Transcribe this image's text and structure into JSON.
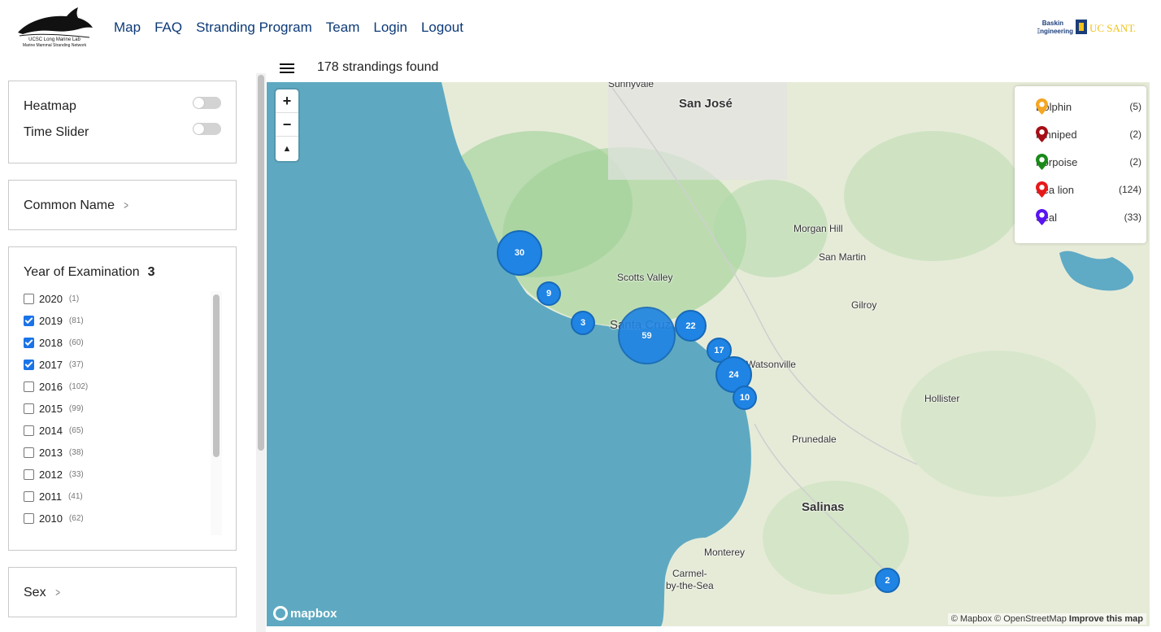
{
  "header": {
    "logo_alt": "UCSC Long Marine Lab Marine Mammal Stranding Network",
    "nav": [
      "Map",
      "FAQ",
      "Stranding Program",
      "Team",
      "Login",
      "Logout"
    ],
    "partner_logo": "Baskin Engineering UC Santa Cruz"
  },
  "status": {
    "found_text": "178 strandings found"
  },
  "filters": {
    "heatmap_label": "Heatmap",
    "timeslider_label": "Time Slider",
    "common_name_label": "Common Name",
    "year_label": "Year of Examination",
    "year_selected_count": "3",
    "years": [
      {
        "year": "2020",
        "count": "(1)",
        "checked": false
      },
      {
        "year": "2019",
        "count": "(81)",
        "checked": true
      },
      {
        "year": "2018",
        "count": "(60)",
        "checked": true
      },
      {
        "year": "2017",
        "count": "(37)",
        "checked": true
      },
      {
        "year": "2016",
        "count": "(102)",
        "checked": false
      },
      {
        "year": "2015",
        "count": "(99)",
        "checked": false
      },
      {
        "year": "2014",
        "count": "(65)",
        "checked": false
      },
      {
        "year": "2013",
        "count": "(38)",
        "checked": false
      },
      {
        "year": "2012",
        "count": "(33)",
        "checked": false
      },
      {
        "year": "2011",
        "count": "(41)",
        "checked": false
      },
      {
        "year": "2010",
        "count": "(62)",
        "checked": false
      }
    ],
    "sex_label": "Sex"
  },
  "map": {
    "zoom_in": "+",
    "zoom_out": "−",
    "compass": "▲",
    "places": [
      "Sunnyvale",
      "San José",
      "Morgan Hill",
      "San Martin",
      "Scotts Valley",
      "Santa Cruz",
      "Gilroy",
      "Watsonville",
      "Hollister",
      "Prunedale",
      "Salinas",
      "Monterey",
      "Carmel-",
      "by-the-Sea"
    ],
    "clusters": [
      "30",
      "9",
      "3",
      "59",
      "22",
      "17",
      "24",
      "10",
      "2"
    ],
    "legend": [
      {
        "name": "Dolphin",
        "count": "(5)",
        "color": "#f5a623"
      },
      {
        "name": "Pinniped",
        "count": "(2)",
        "color": "#a50f15"
      },
      {
        "name": "Porpoise",
        "count": "(2)",
        "color": "#1a8a1a"
      },
      {
        "name": "Sea lion",
        "count": "(124)",
        "color": "#e61919"
      },
      {
        "name": "Seal",
        "count": "(33)",
        "color": "#5a14f0"
      }
    ],
    "mapbox_logo": "mapbox",
    "attribution": "© Mapbox © OpenStreetMap",
    "improve": "Improve this map"
  }
}
